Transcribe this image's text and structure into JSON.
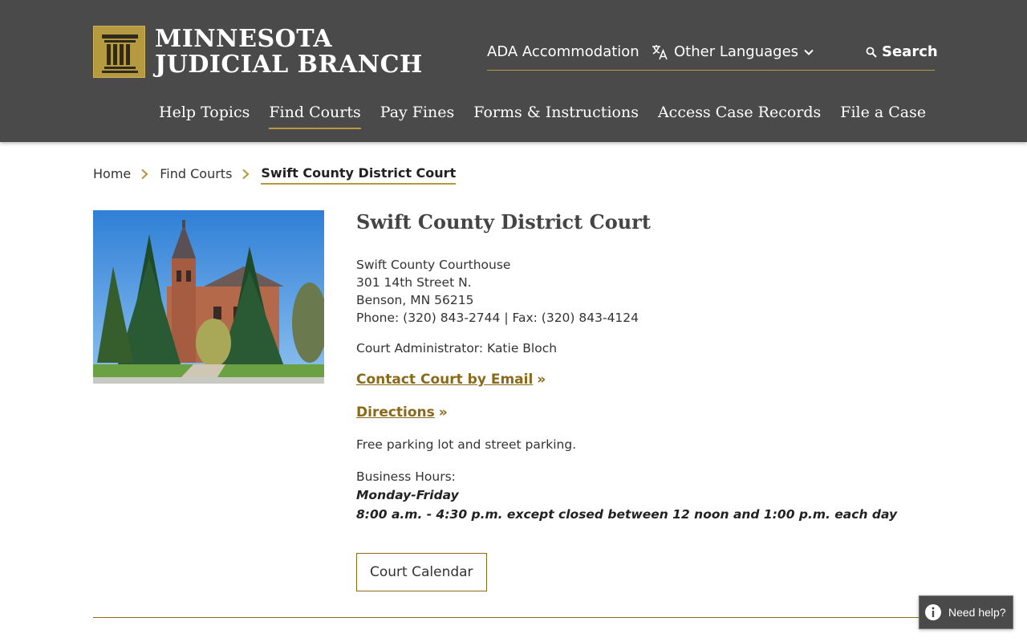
{
  "header": {
    "logo_line1": "MINNESOTA",
    "logo_line2": "JUDICIAL BRANCH",
    "utility": {
      "ada": "ADA Accommodation",
      "languages": "Other Languages",
      "search": "Search"
    },
    "nav": [
      "Help Topics",
      "Find Courts",
      "Pay Fines",
      "Forms & Instructions",
      "Access Case Records",
      "File a Case"
    ],
    "active_nav": "Find Courts"
  },
  "breadcrumb": [
    "Home",
    "Find Courts",
    "Swift County District Court"
  ],
  "court": {
    "title": "Swift County District Court",
    "address_lines": [
      "Swift County Courthouse",
      "301 14th Street N.",
      "Benson, MN 56215",
      "Phone: (320) 843-2744 | Fax: (320) 843-4124"
    ],
    "administrator": "Court Administrator: Katie Bloch",
    "email_link": "Contact Court by Email",
    "directions_link": "Directions",
    "link_suffix": "»",
    "parking": "Free parking lot and street parking.",
    "hours_label": "Business Hours:",
    "hours_days": "Monday-Friday",
    "hours_times": "8:00 a.m. - 4:30 p.m. except closed between 12 noon and 1:00 p.m. each day",
    "calendar_button": "Court Calendar"
  },
  "help_widget": "Need help?",
  "colors": {
    "header_bg": "#4a4a4a",
    "accent_gold": "#b59a3f",
    "link_gold": "#8a6a1a"
  }
}
